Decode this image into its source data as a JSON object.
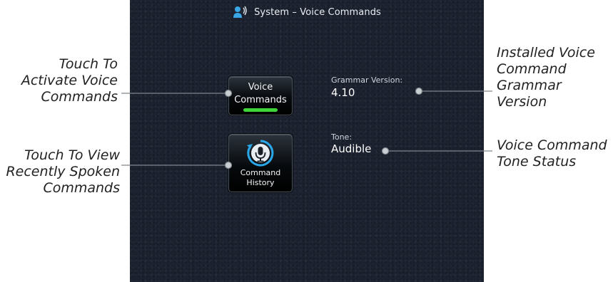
{
  "screen": {
    "title": "System – Voice Commands",
    "title_icon": "voice-person-icon"
  },
  "buttons": {
    "voice_commands": {
      "line1": "Voice",
      "line2": "Commands",
      "indicator_color": "#3ed43a",
      "active": true
    },
    "command_history": {
      "line1": "Command",
      "line2": "History",
      "icon": "microphone-history-icon"
    }
  },
  "info": {
    "grammar_version_label": "Grammar Version:",
    "grammar_version_value": "4.10",
    "tone_label": "Tone:",
    "tone_value": "Audible"
  },
  "callouts": {
    "activate": [
      "Touch To",
      "Activate Voice",
      "Commands"
    ],
    "history": [
      "Touch To View",
      "Recently Spoken",
      "Commands"
    ],
    "grammar": [
      "Installed Voice",
      "Command",
      "Grammar",
      "Version"
    ],
    "tone": [
      "Voice Command",
      "Tone Status"
    ]
  },
  "colors": {
    "screen_bg": "#1c2230",
    "accent_green": "#3ed43a",
    "icon_blue": "#2aa7e8"
  }
}
